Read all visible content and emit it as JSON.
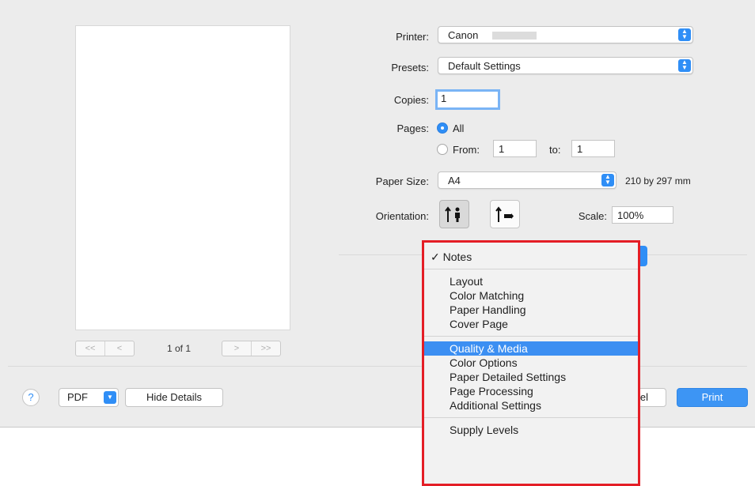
{
  "print": {
    "printer_label": "Printer:",
    "printer_value": "Canon",
    "presets_label": "Presets:",
    "presets_value": "Default Settings",
    "copies_label": "Copies:",
    "copies_value": "1",
    "pages_label": "Pages:",
    "pages_all": "All",
    "pages_from": "From:",
    "pages_from_value": "1",
    "pages_to": "to:",
    "pages_to_value": "1",
    "paper_size_label": "Paper Size:",
    "paper_size_value": "A4",
    "paper_size_dims": "210 by 297 mm",
    "orientation_label": "Orientation:",
    "scale_label": "Scale:",
    "scale_value": "100%"
  },
  "preview": {
    "first": "<<",
    "prev": "<",
    "page_count": "1 of 1",
    "next": ">",
    "last": ">>"
  },
  "footer": {
    "help": "?",
    "pdf": "PDF",
    "hide_details": "Hide Details",
    "cancel_partial": "el",
    "print": "Print"
  },
  "menu": {
    "checked": "✓ Notes",
    "group1": [
      "Layout",
      "Color Matching",
      "Paper Handling",
      "Cover Page"
    ],
    "group2": [
      "Quality & Media",
      "Color Options",
      "Paper Detailed Settings",
      "Page Processing",
      "Additional Settings"
    ],
    "group3": [
      "Supply Levels"
    ],
    "highlighted": "Quality & Media"
  },
  "colors": {
    "accent": "#2f8ef6",
    "highlight_box": "#e41e26"
  }
}
